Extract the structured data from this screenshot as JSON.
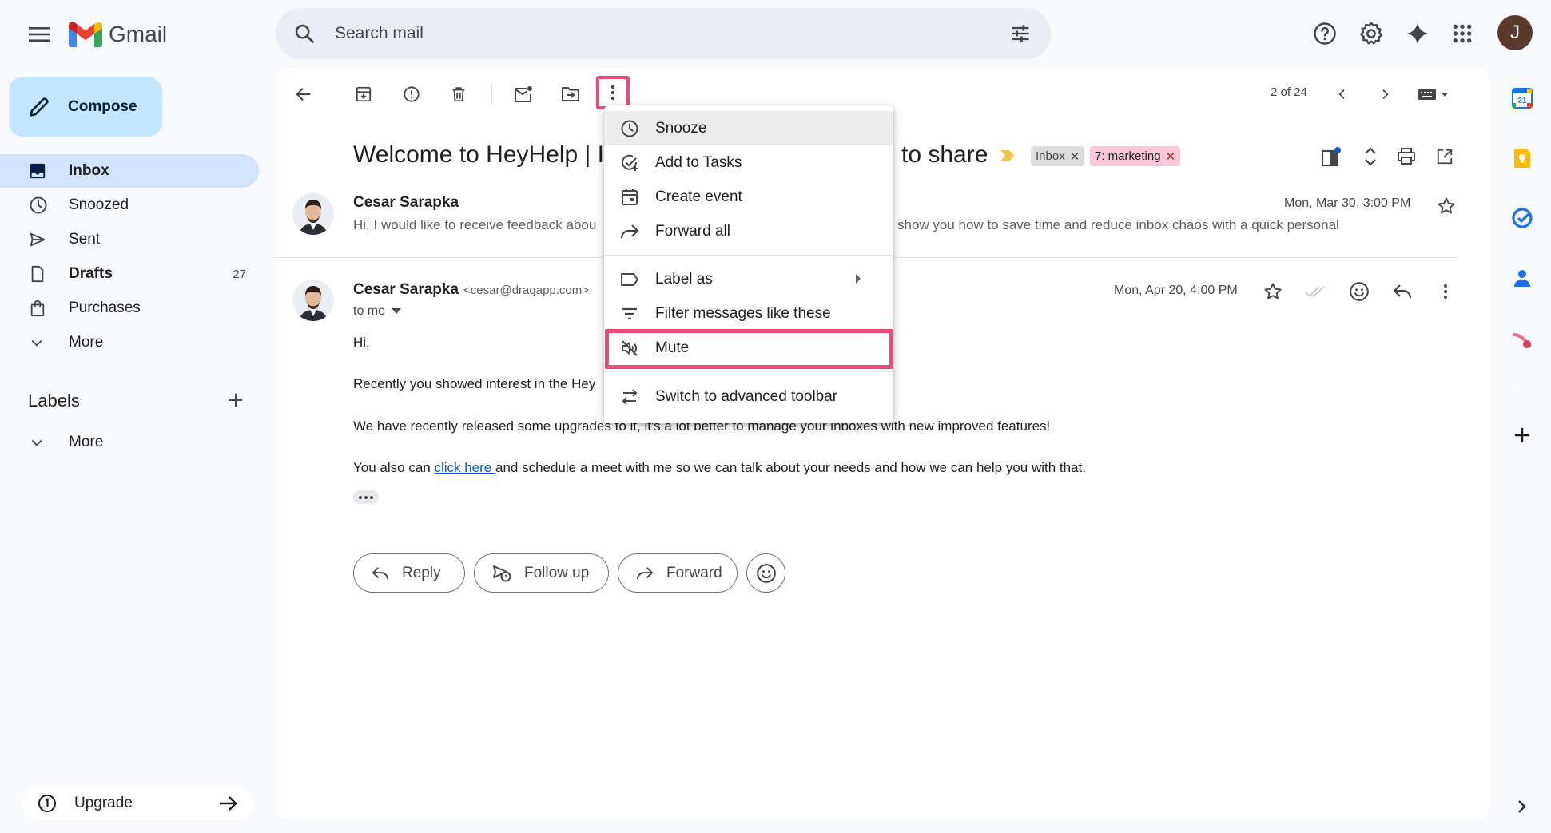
{
  "app": {
    "name": "Gmail"
  },
  "search": {
    "placeholder": "Search mail"
  },
  "account": {
    "initial": "J"
  },
  "compose": {
    "label": "Compose"
  },
  "nav": {
    "items": [
      {
        "label": "Inbox",
        "count": ""
      },
      {
        "label": "Snoozed",
        "count": ""
      },
      {
        "label": "Sent",
        "count": ""
      },
      {
        "label": "Drafts",
        "count": "27"
      },
      {
        "label": "Purchases",
        "count": ""
      },
      {
        "label": "More",
        "count": ""
      }
    ],
    "labels_header": "Labels",
    "labels_more": "More",
    "upgrade": "Upgrade"
  },
  "toolbar": {
    "pager": "2 of 24"
  },
  "email": {
    "subject_start": "Welcome to HeyHelp | I",
    "subject_end": "to share",
    "tags": [
      "Inbox",
      "7: marketing"
    ],
    "messages": [
      {
        "sender": "Cesar Sarapka",
        "date": "Mon, Mar 30, 3:00 PM",
        "snippet_left": "Hi, I would like to receive feedback abou",
        "snippet_right": "show you how to save time and reduce inbox chaos with a quick personal"
      },
      {
        "sender": "Cesar Sarapka",
        "email": "<cesar@dragapp.com>",
        "to": "to me",
        "date": "Mon, Apr 20, 4:00 PM",
        "body": {
          "greeting": "Hi,",
          "line1": "Recently you showed interest in the Hey",
          "line2": "We have recently released some upgrades to it, it's a lot better to manage your inboxes with new improved features!",
          "line3_before": "You also can ",
          "line3_link": "click here ",
          "line3_after": "and schedule a meet with me so we can talk about your needs and how we can help you with that."
        }
      }
    ]
  },
  "actions": {
    "reply": "Reply",
    "follow_up": "Follow up",
    "forward": "Forward"
  },
  "menu": {
    "items": [
      {
        "label": "Snooze",
        "icon": "clock-icon"
      },
      {
        "label": "Add to Tasks",
        "icon": "add-task-icon"
      },
      {
        "label": "Create event",
        "icon": "calendar-icon"
      },
      {
        "label": "Forward all",
        "icon": "forward-icon"
      },
      {
        "label": "Label as",
        "icon": "label-icon"
      },
      {
        "label": "Filter messages like these",
        "icon": "filter-icon"
      },
      {
        "label": "Mute",
        "icon": "mute-icon"
      },
      {
        "label": "Switch to advanced toolbar",
        "icon": "swap-icon"
      }
    ]
  },
  "colors": {
    "accent_highlight": "#ea4c7a",
    "inbox_active": "#d3e3fd",
    "compose": "#c2e7ff"
  }
}
